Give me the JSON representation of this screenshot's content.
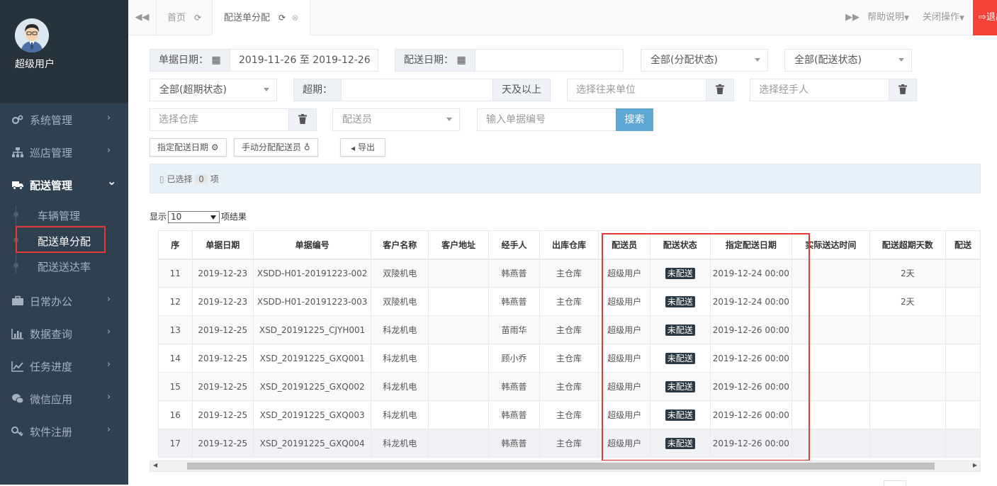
{
  "sidebar": {
    "username": "超级用户",
    "menu": [
      {
        "label": "系统管理",
        "icon": "gears-icon",
        "arrow": "›"
      },
      {
        "label": "巡店管理",
        "icon": "sitemap-icon",
        "arrow": "›"
      },
      {
        "label": "配送管理",
        "icon": "truck-icon",
        "arrow": "⌄"
      },
      {
        "label": "日常办公",
        "icon": "briefcase-icon",
        "arrow": "›"
      },
      {
        "label": "数据查询",
        "icon": "bar-chart-icon",
        "arrow": "›"
      },
      {
        "label": "任务进度",
        "icon": "line-chart-icon",
        "arrow": "›"
      },
      {
        "label": "微信应用",
        "icon": "wechat-icon",
        "arrow": "›"
      },
      {
        "label": "软件注册",
        "icon": "key-icon",
        "arrow": "›"
      }
    ],
    "submenu": [
      {
        "label": "车辆管理"
      },
      {
        "label": "配送单分配"
      },
      {
        "label": "配送送达率"
      }
    ]
  },
  "tabs": {
    "home": "首页",
    "active": "配送单分配",
    "help": "帮助说明",
    "close_ops": "关闭操作",
    "logout": "退出"
  },
  "filters": {
    "doc_date_label": "单据日期：",
    "doc_date_value": "2019-11-26 至 2019-12-26",
    "delivery_date_label": "配送日期：",
    "delivery_date_value": "",
    "alloc_status": "全部(分配状态)",
    "delivery_status": "全部(配送状态)",
    "overdue_status": "全部(超期状态)",
    "overdue_label": "超期：",
    "overdue_suffix": "天及以上",
    "partner_placeholder": "选择往来单位",
    "handler_placeholder": "选择经手人",
    "warehouse_placeholder": "选择仓库",
    "courier_placeholder": "配送员",
    "docno_placeholder": "输入单据编号",
    "search_label": "搜索"
  },
  "toolbar": {
    "set_date": "指定配送日期",
    "assign_courier": "手动分配配送员",
    "export": "导出"
  },
  "selection": {
    "prefix": "已选择",
    "count": "0",
    "suffix": "项"
  },
  "length_menu": {
    "prefix": "显示",
    "value": "10",
    "suffix": "项结果"
  },
  "table": {
    "headers": [
      "序",
      "单据日期",
      "单据编号",
      "客户名称",
      "客户地址",
      "经手人",
      "出库仓库",
      "配送员",
      "配送状态",
      "指定配送日期",
      "实际送达时间",
      "配送超期天数",
      "配送"
    ],
    "rows": [
      [
        "11",
        "2019-12-23",
        "XSDD-H01-20191223-002",
        "双陵机电",
        "",
        "韩燕普",
        "主仓库",
        "超级用户",
        "未配送",
        "2019-12-24 00:00",
        "",
        "2天"
      ],
      [
        "12",
        "2019-12-23",
        "XSDD-H01-20191223-003",
        "双陵机电",
        "",
        "韩燕普",
        "主仓库",
        "超级用户",
        "未配送",
        "2019-12-24 00:00",
        "",
        "2天"
      ],
      [
        "13",
        "2019-12-25",
        "XSD_20191225_CJYH001",
        "科龙机电",
        "",
        "苗雨华",
        "主仓库",
        "超级用户",
        "未配送",
        "2019-12-26 00:00",
        "",
        ""
      ],
      [
        "14",
        "2019-12-25",
        "XSD_20191225_GXQ001",
        "科龙机电",
        "",
        "顾小乔",
        "主仓库",
        "超级用户",
        "未配送",
        "2019-12-26 00:00",
        "",
        ""
      ],
      [
        "15",
        "2019-12-25",
        "XSD_20191225_GXQ002",
        "科龙机电",
        "",
        "韩燕普",
        "主仓库",
        "超级用户",
        "未配送",
        "2019-12-26 00:00",
        "",
        ""
      ],
      [
        "16",
        "2019-12-25",
        "XSD_20191225_GXQ003",
        "科龙机电",
        "",
        "韩燕普",
        "主仓库",
        "超级用户",
        "未配送",
        "2019-12-26 00:00",
        "",
        ""
      ],
      [
        "17",
        "2019-12-25",
        "XSD_20191225_GXQ004",
        "科龙机电",
        "",
        "韩燕普",
        "主仓库",
        "超级用户",
        "未配送",
        "2019-12-26 00:00",
        "",
        ""
      ]
    ]
  },
  "colors": {
    "sidebar_bg": "#2f4050",
    "highlight": "#e53935",
    "status_badge": "#2b3a44",
    "logout": "#f44336"
  }
}
